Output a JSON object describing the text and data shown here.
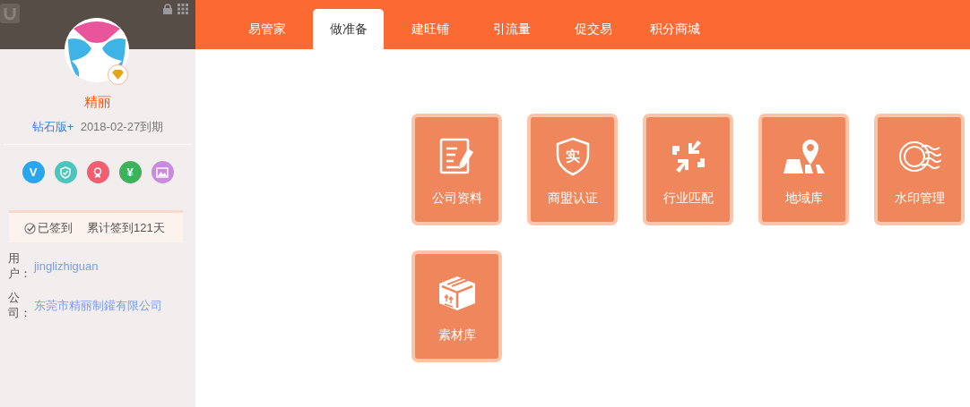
{
  "sidebar": {
    "name": "精丽",
    "edition": "钻石版+",
    "expiry": "2018-02-27到期",
    "badges": [
      {
        "kind": "glyph",
        "glyph": "V",
        "color": "#2aa6ef"
      },
      {
        "kind": "shield",
        "color": "#4cc6bc"
      },
      {
        "kind": "award",
        "color": "#ef5f6f"
      },
      {
        "kind": "glyph",
        "glyph": "¥",
        "color": "#3cb35a"
      },
      {
        "kind": "image",
        "color": "#c88be0"
      }
    ],
    "checkin": {
      "checked": true,
      "label": "已签到",
      "total": "累计签到121天"
    },
    "info": [
      {
        "label": "用户：",
        "value": "jinglizhiguan"
      },
      {
        "label": "公司：",
        "value": "东莞市精丽制鑵有限公司"
      }
    ]
  },
  "tabs": [
    {
      "label": "易管家",
      "selected": false
    },
    {
      "label": "做准备",
      "selected": true
    },
    {
      "label": "建旺铺",
      "selected": false
    },
    {
      "label": "引流量",
      "selected": false
    },
    {
      "label": "促交易",
      "selected": false
    },
    {
      "label": "积分商城",
      "selected": false
    }
  ],
  "tiles": [
    {
      "kind": "document",
      "label": "公司资料"
    },
    {
      "kind": "shield",
      "glyph": "实",
      "label": "商盟认证"
    },
    {
      "kind": "arrows",
      "label": "行业匹配"
    },
    {
      "kind": "map",
      "label": "地域库"
    },
    {
      "kind": "stamp",
      "label": "水印管理"
    },
    {
      "kind": "box",
      "label": "素材库"
    }
  ]
}
